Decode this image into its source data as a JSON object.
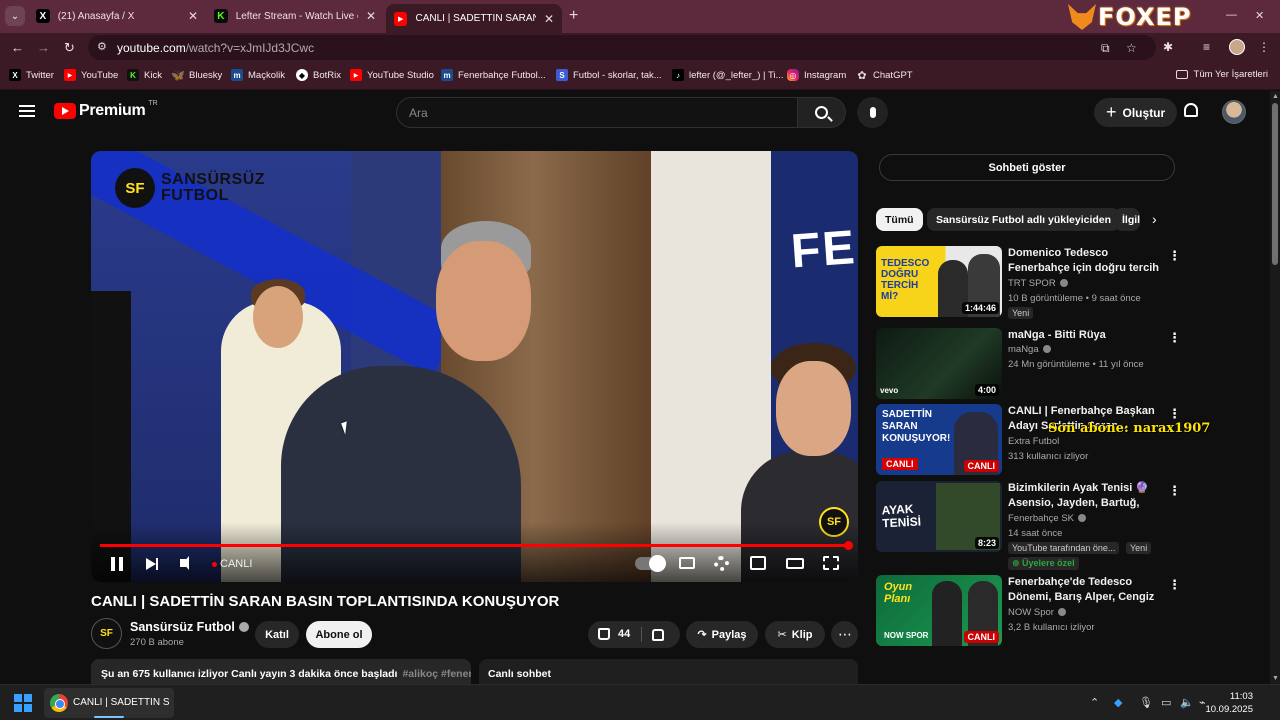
{
  "browser": {
    "tabs": [
      {
        "title": "(21) Anasayfa / X",
        "favicon": "X"
      },
      {
        "title": "Lefter Stream - Watch Live on Kick",
        "favicon": "K"
      },
      {
        "title": "CANLI | SADETTİN SARAN BASIN TOPLANTISINDA KONUŞUYOR",
        "favicon": "▶"
      }
    ],
    "brand": "FOXEP",
    "url_host": "youtube.com",
    "url_path": "/watch?v=xJmIJd3JCwc",
    "bookmarks": [
      "Twitter",
      "YouTube",
      "Kick",
      "Bluesky",
      "Maçkolik",
      "BotRix",
      "YouTube Studio",
      "Fenerbahçe Futbol...",
      "Futbol - skorlar, tak...",
      "lefter (@_lefter_) | Ti...",
      "Instagram",
      "ChatGPT"
    ],
    "all_bookmarks": "Tüm Yer İşaretleri"
  },
  "youtube": {
    "logo_text": "Premium",
    "country": "TR",
    "search_placeholder": "Ara",
    "create_label": "Oluştur",
    "video": {
      "brand_line1": "SANSÜRSÜZ",
      "brand_line2": "FUTBOL",
      "badge": "SF",
      "live_label": "CANLI",
      "wall_text": "FEN"
    },
    "title": "CANLI | SADETTİN SARAN BASIN TOPLANTISINDA KONUŞUYOR",
    "channel": {
      "name": "Sansürsüz Futbol",
      "subs": "270 B abone",
      "avatar": "SF"
    },
    "join_label": "Katıl",
    "subscribe_label": "Abone ol",
    "likes": "44",
    "share_label": "Paylaş",
    "clip_label": "Klip",
    "description_line": "Şu an 675 kullanıcı izliyor  Canlı yayın 3 dakika önce başladı",
    "description_tags": "#alikoç #fenerbahçe",
    "live_chat_label": "Canlı sohbet",
    "show_chat_label": "Sohbeti göster",
    "chips": [
      "Tümü",
      "Sansürsüz Futbol adlı yükleyiciden",
      "İlgili"
    ],
    "recommendations": [
      {
        "title": "Domenico Tedesco Fenerbahçe için doğru tercih mi? | Avrupa ...",
        "channel": "TRT SPOR",
        "meta": "10 B görüntüleme • 9 saat önce",
        "duration": "1:44:46",
        "badge": "Yeni",
        "thumb_text": "TEDESCO DOĞRU TERCİH Mİ?"
      },
      {
        "title": "maNga - Bitti Rüya",
        "channel": "maNga",
        "meta": "24 Mn görüntüleme • 11 yıl önce",
        "duration": "4:00",
        "thumb_text": "vevo"
      },
      {
        "title": "CANLI | Fenerbahçe Başkan Adayı Sadettin Saran...",
        "channel": "Extra Futbol",
        "meta": "313 kullanıcı izliyor",
        "live": "CANLI",
        "thumb_text": "SADETTİN SARAN KONUŞUYOR!",
        "thumb_live": "CANLI"
      },
      {
        "title": "Bizimkilerin Ayak Tenisi 🔮 Asensio, Jayden, Bartuğ, Beca...",
        "channel": "Fenerbahçe SK",
        "meta": "14 saat önce",
        "duration": "8:23",
        "badge": "YouTube tarafından öne...",
        "badge2": "Yeni",
        "members": "Üyelere özel",
        "thumb_text": "AYAK TENİSİ"
      },
      {
        "title": "Fenerbahçe'de Tedesco Dönemi, Barış Alper, Cengiz Ünder | Ers...",
        "channel": "NOW Spor",
        "meta": "3,2 B kullanıcı izliyor",
        "live": "CANLI",
        "thumb_text": "Oyun Planı",
        "thumb_sub": "NOW SPOR",
        "thumb_live": "CANLI"
      }
    ]
  },
  "overlay_text": "Son abone: narax1907",
  "taskbar": {
    "app_label": "CANLI | SADETTİN SARAN",
    "time": "11:03",
    "date": "10.09.2025"
  },
  "colors": {
    "tab_bar": "#5c2a3c",
    "toolbar": "#3b1a26",
    "youtube_bg": "#0f0f0f",
    "accent_red": "#ff0000"
  }
}
